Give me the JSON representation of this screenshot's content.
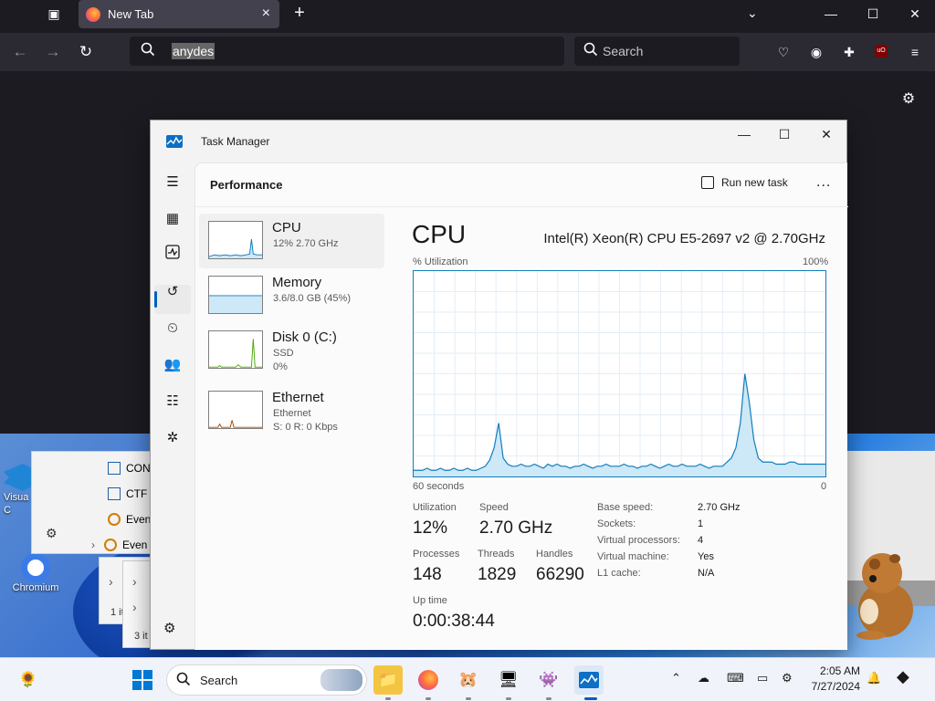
{
  "browser": {
    "tab_title": "New Tab",
    "url_text": "anydes",
    "search_placeholder": "Search"
  },
  "desktop": {
    "icons": [
      {
        "label": "Visua\nC",
        "name": "visual-studio-code-shortcut"
      },
      {
        "label": "Chromium",
        "name": "chromium-shortcut"
      }
    ],
    "bg_rows": [
      "CON",
      "CTF",
      "Even",
      "Even"
    ],
    "bg_items_1": "1 it",
    "bg_items_2": "3 it"
  },
  "task_manager": {
    "title": "Task Manager",
    "page_title": "Performance",
    "run_new_task": "Run new task",
    "more": "...",
    "perf_items": [
      {
        "name": "CPU",
        "sub1": "12%  2.70 GHz",
        "sub2": "",
        "sub3": ""
      },
      {
        "name": "Memory",
        "sub1": "3.6/8.0 GB (45%)",
        "sub2": "",
        "sub3": ""
      },
      {
        "name": "Disk 0 (C:)",
        "sub1": "SSD",
        "sub2": "0%",
        "sub3": ""
      },
      {
        "name": "Ethernet",
        "sub1": "Ethernet",
        "sub2": "S: 0  R: 0 Kbps",
        "sub3": ""
      }
    ],
    "cpu": {
      "heading": "CPU",
      "model": "Intel(R) Xeon(R) CPU E5-2697 v2 @ 2.70GHz",
      "util_label": "% Utilization",
      "max_label": "100%",
      "time_label": "60 seconds",
      "zero_label": "0",
      "utilization_label": "Utilization",
      "utilization": "12%",
      "speed_label": "Speed",
      "speed": "2.70 GHz",
      "processes_label": "Processes",
      "processes": "148",
      "threads_label": "Threads",
      "threads": "1829",
      "handles_label": "Handles",
      "handles": "66290",
      "uptime_label": "Up time",
      "uptime": "0:00:38:44",
      "details": [
        {
          "k": "Base speed:",
          "v": "2.70 GHz"
        },
        {
          "k": "Sockets:",
          "v": "1"
        },
        {
          "k": "Virtual processors:",
          "v": "4"
        },
        {
          "k": "Virtual machine:",
          "v": "Yes"
        },
        {
          "k": "L1 cache:",
          "v": "N/A"
        }
      ],
      "history": [
        3,
        3,
        3,
        4,
        3,
        3,
        4,
        3,
        3,
        4,
        3,
        3,
        4,
        3,
        3,
        4,
        5,
        8,
        14,
        26,
        9,
        6,
        5,
        5,
        6,
        5,
        5,
        6,
        5,
        4,
        6,
        5,
        6,
        5,
        5,
        4,
        5,
        5,
        6,
        5,
        4,
        5,
        5,
        6,
        5,
        5,
        5,
        6,
        5,
        5,
        4,
        5,
        5,
        6,
        5,
        4,
        5,
        6,
        5,
        5,
        6,
        5,
        5,
        5,
        6,
        5,
        4,
        5,
        5,
        5,
        7,
        9,
        14,
        26,
        50,
        36,
        18,
        9,
        7,
        7,
        7,
        6,
        6,
        6,
        7,
        7,
        6,
        6,
        6,
        6,
        6,
        6,
        6
      ]
    }
  },
  "taskbar": {
    "search_label": "Search",
    "time": "2:05 AM",
    "date": "7/27/2024"
  },
  "colors": {
    "cpu_line": "#117dbb",
    "cpu_fill": "#cde8f7",
    "memory": "#8b12ae",
    "disk": "#4da60c",
    "ethernet": "#a74f01"
  }
}
